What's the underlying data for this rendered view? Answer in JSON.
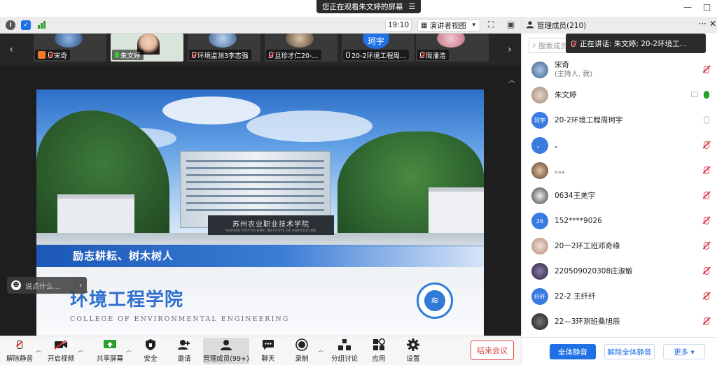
{
  "share_banner": {
    "text": "您正在观看朱文婷的屏幕",
    "menu_icon": "menu-icon"
  },
  "window": {
    "minimize": "—",
    "maximize": "□"
  },
  "info_bar": {
    "timer": "19:10",
    "view_label": "演讲者视图",
    "view_caret": "▾",
    "fullscreen_glyph": "⛶",
    "sidebar_glyph": "▣"
  },
  "thumbnails": [
    {
      "name": "宋奇",
      "mic": "muted",
      "tag": "host-badge"
    },
    {
      "name": "朱文婷",
      "mic": "on"
    },
    {
      "name": "环境监测3李志强",
      "mic": "muted"
    },
    {
      "name": "旦珍才仁20-...",
      "mic": "muted"
    },
    {
      "name": "20-2环境工程周...",
      "mic": "open",
      "avatar_text": "珂宇"
    },
    {
      "name": "周潘浩",
      "mic": "muted"
    }
  ],
  "slide": {
    "sign_cn": "苏州农业职业技术学院",
    "sign_en": "SUZHOU POLYTECHNIC INSTITUTE OF AGRICULTURE",
    "motto": "励志耕耘、树木树人",
    "college_cn": "环境工程学院",
    "college_en": "COLLEGE OF ENVIRONMENTAL ENGINEERING"
  },
  "chat_pill": {
    "placeholder": "说点什么..."
  },
  "toolbar": {
    "items": [
      {
        "label": "解除静音",
        "icon": "mic-muted-icon"
      },
      {
        "label": "开启视频",
        "icon": "camera-off-icon"
      },
      {
        "label": "共享屏幕",
        "icon": "share-screen-icon"
      },
      {
        "label": "安全",
        "icon": "shield-icon"
      },
      {
        "label": "邀请",
        "icon": "invite-icon"
      },
      {
        "label": "管理成员(99+)",
        "icon": "members-icon"
      },
      {
        "label": "聊天",
        "icon": "chat-icon"
      },
      {
        "label": "录制",
        "icon": "record-icon"
      },
      {
        "label": "分组讨论",
        "icon": "breakout-icon"
      },
      {
        "label": "应用",
        "icon": "apps-icon"
      },
      {
        "label": "设置",
        "icon": "settings-icon"
      }
    ],
    "end_label": "结束会议"
  },
  "panel": {
    "title": "管理成员(210)",
    "more": "···",
    "close": "✕",
    "search_placeholder": "搜索成员",
    "speaking": "正在讲话: 朱文婷; 20-2环境工...",
    "participants": [
      {
        "name": "宋奇",
        "sub": "(主持人, 我)",
        "avatar": "",
        "avatar_color": "#6a8fb5",
        "mic": "muted"
      },
      {
        "name": "朱文婷",
        "sub": "",
        "avatar": "",
        "avatar_color": "#c9b7a8",
        "mic": "speak",
        "camera": true
      },
      {
        "name": "20-2环境工程周珂宇",
        "sub": "",
        "avatar": "珂宇",
        "avatar_color": "#3a7be0",
        "mic": "open"
      },
      {
        "name": "。",
        "sub": "",
        "avatar": "。",
        "avatar_color": "#3a7be0",
        "mic": "muted"
      },
      {
        "name": "。。。",
        "sub": "",
        "avatar": "",
        "avatar_color": "#6b4a3a",
        "mic": "muted"
      },
      {
        "name": "0634王羌宇",
        "sub": "",
        "avatar": "",
        "avatar_color": "#4a4a4a",
        "mic": "muted"
      },
      {
        "name": "152****9026",
        "sub": "",
        "avatar": "26",
        "avatar_color": "#3a7be0",
        "mic": "muted"
      },
      {
        "name": "20一2环工班邓奇缘",
        "sub": "",
        "avatar": "",
        "avatar_color": "#c8b4a8",
        "mic": "muted"
      },
      {
        "name": "220509020308庄淑敏",
        "sub": "",
        "avatar": "",
        "avatar_color": "#3d3550",
        "mic": "muted"
      },
      {
        "name": "22-2 王纤纤",
        "sub": "",
        "avatar": "纤纤",
        "avatar_color": "#3a7be0",
        "mic": "muted"
      },
      {
        "name": "22—3环测班桑旭辰",
        "sub": "",
        "avatar": "",
        "avatar_color": "#2a2a2a",
        "mic": "muted"
      }
    ],
    "footer": {
      "mute_all": "全体静音",
      "unmute_all": "解除全体静音",
      "more": "更多 ▾"
    }
  }
}
